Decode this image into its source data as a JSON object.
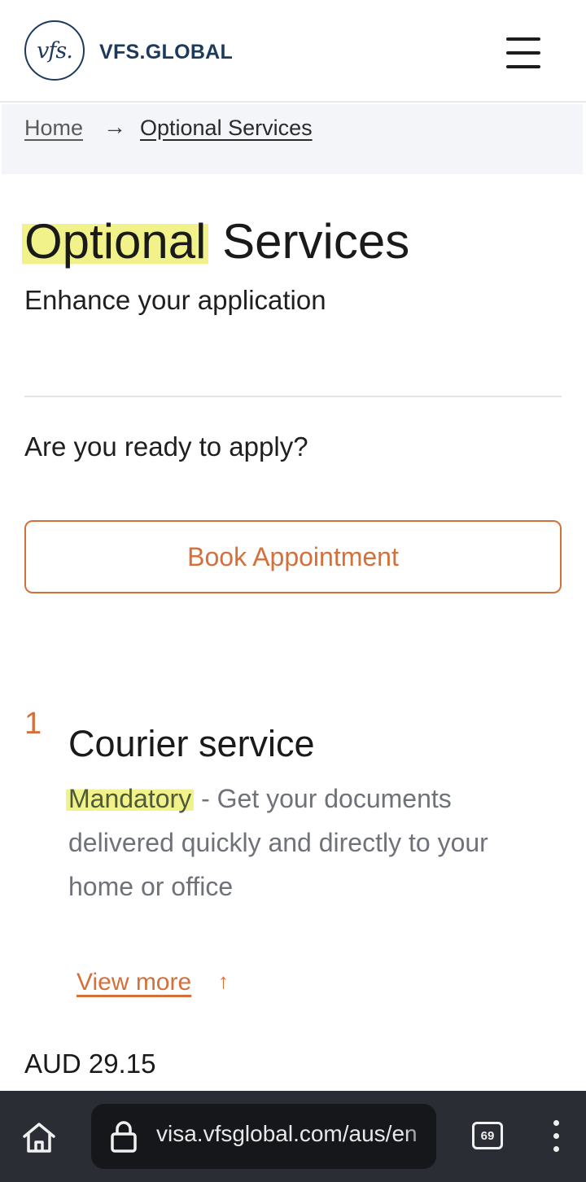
{
  "header": {
    "logo_mark": "vfs.",
    "logo_text": "VFS.GLOBAL",
    "menu_icon": "hamburger-menu-icon"
  },
  "breadcrumb": {
    "home": "Home",
    "separator_icon": "arrow-right-icon",
    "current": "Optional Services"
  },
  "page": {
    "title_highlighted": "Optional",
    "title_rest": " Services",
    "subtitle": "Enhance your application",
    "ready_question": "Are you ready to apply?",
    "book_button": "Book Appointment",
    "accent_color": "#d4703a",
    "highlight_color": "#f1f38a"
  },
  "service": {
    "number": "1",
    "title": "Courier service",
    "desc_highlighted": "Mandatory",
    "desc_rest": " - Get your documents delivered quickly and directly to your home or office",
    "view_more": "View more",
    "view_more_icon": "arrow-up-icon",
    "price": "AUD 29.15"
  },
  "browser": {
    "home_icon": "home-icon",
    "lock_icon": "lock-icon",
    "url": "visa.vfsglobal.com/aus/en",
    "tab_count": "69",
    "more_icon": "more-vertical-icon",
    "bar_color": "#2a2d33"
  }
}
